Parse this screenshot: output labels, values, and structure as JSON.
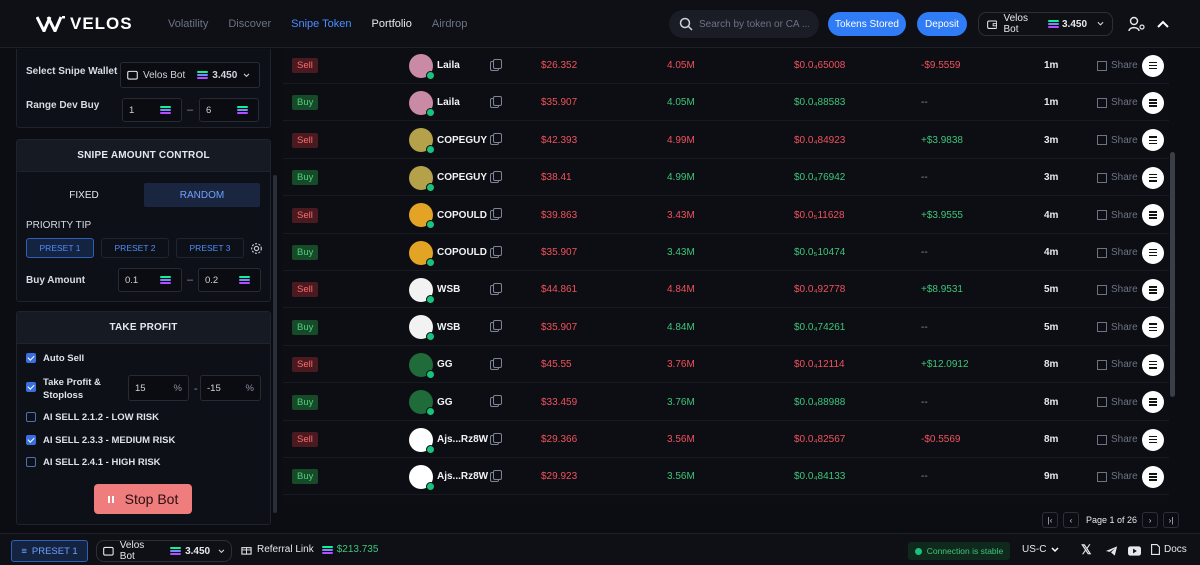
{
  "header": {
    "brand": "VELOS",
    "nav": [
      "Volatility",
      "Discover",
      "Snipe Token",
      "Portfolio",
      "Airdrop"
    ],
    "search_placeholder": "Search by token or CA ...",
    "tokens_stored": "Tokens Stored",
    "deposit": "Deposit",
    "wallet_name": "Velos Bot",
    "wallet_balance": "3.450"
  },
  "left": {
    "select_wallet_label": "Select Snipe Wallet",
    "wallet_name": "Velos Bot",
    "wallet_balance": "3.450",
    "range_dev_buy_label": "Range Dev Buy",
    "range_min": "1",
    "range_max": "6",
    "snipe_amount_title": "SNIPE AMOUNT CONTROL",
    "fixed_label": "FIXED",
    "random_label": "RANDOM",
    "priority_tip_label": "PRIORITY TIP",
    "presets": [
      "PRESET 1",
      "PRESET 2",
      "PRESET 3"
    ],
    "buy_amount_label": "Buy Amount",
    "buy_min": "0.1",
    "buy_max": "0.2",
    "take_profit_title": "TAKE PROFIT",
    "auto_sell": "Auto Sell",
    "tp_sl_label": "Take Profit & Stoploss",
    "tp_value": "15",
    "sl_value": "-15",
    "percent": "%",
    "ai_low": "AI SELL 2.1.2 - LOW RISK",
    "ai_medium": "AI SELL 2.3.3 - MEDIUM RISK",
    "ai_high": "AI SELL 2.4.1 - HIGH RISK",
    "stop_bot": "Stop Bot"
  },
  "rows": [
    {
      "side": "Sell",
      "token": "Laila",
      "avatar_color": "#c98aa6",
      "price": "$26.352",
      "mcap": "4.05M",
      "amount": "$0.0₄65008",
      "pnl": "-$9.5559",
      "time": "1m"
    },
    {
      "side": "Buy",
      "token": "Laila",
      "avatar_color": "#c98aa6",
      "price": "$35.907",
      "mcap": "4.05M",
      "amount": "$0.0₄88583",
      "pnl": "--",
      "time": "1m"
    },
    {
      "side": "Sell",
      "token": "COPEGUY",
      "avatar_color": "#b5a14a",
      "price": "$42.393",
      "mcap": "4.99M",
      "amount": "$0.0₄84923",
      "pnl": "+$3.9838",
      "time": "3m"
    },
    {
      "side": "Buy",
      "token": "COPEGUY",
      "avatar_color": "#b5a14a",
      "price": "$38.41",
      "mcap": "4.99M",
      "amount": "$0.0₄76942",
      "pnl": "--",
      "time": "3m"
    },
    {
      "side": "Sell",
      "token": "COPOULD",
      "avatar_color": "#e3a325",
      "price": "$39.863",
      "mcap": "3.43M",
      "amount": "$0.0₅11628",
      "pnl": "+$3.9555",
      "time": "4m"
    },
    {
      "side": "Buy",
      "token": "COPOULD",
      "avatar_color": "#e3a325",
      "price": "$35.907",
      "mcap": "3.43M",
      "amount": "$0.0₅10474",
      "pnl": "--",
      "time": "4m"
    },
    {
      "side": "Sell",
      "token": "WSB",
      "avatar_color": "#f2f2f2",
      "price": "$44.861",
      "mcap": "4.84M",
      "amount": "$0.0₄92778",
      "pnl": "+$8.9531",
      "time": "5m"
    },
    {
      "side": "Buy",
      "token": "WSB",
      "avatar_color": "#f2f2f2",
      "price": "$35.907",
      "mcap": "4.84M",
      "amount": "$0.0₄74261",
      "pnl": "--",
      "time": "5m"
    },
    {
      "side": "Sell",
      "token": "GG",
      "avatar_color": "#1f6b3a",
      "price": "$45.55",
      "mcap": "3.76M",
      "amount": "$0.0₄12114",
      "pnl": "+$12.0912",
      "time": "8m"
    },
    {
      "side": "Buy",
      "token": "GG",
      "avatar_color": "#1f6b3a",
      "price": "$33.459",
      "mcap": "3.76M",
      "amount": "$0.0₄88988",
      "pnl": "--",
      "time": "8m"
    },
    {
      "side": "Sell",
      "token": "Ajs...Rz8W",
      "avatar_color": "#ffffff",
      "price": "$29.366",
      "mcap": "3.56M",
      "amount": "$0.0₄82567",
      "pnl": "-$0.5569",
      "time": "8m"
    },
    {
      "side": "Buy",
      "token": "Ajs...Rz8W",
      "avatar_color": "#ffffff",
      "price": "$29.923",
      "mcap": "3.56M",
      "amount": "$0.0₄84133",
      "pnl": "--",
      "time": "9m"
    }
  ],
  "share_label": "Share",
  "pagination": {
    "label": "Page 1 of 26"
  },
  "footer": {
    "preset": "PRESET 1",
    "wallet_name": "Velos Bot",
    "wallet_balance": "3.450",
    "referral": "Referral Link",
    "referral_value": "$213.735",
    "connection": "Connection is stable",
    "region": "US-C",
    "docs": "Docs"
  }
}
